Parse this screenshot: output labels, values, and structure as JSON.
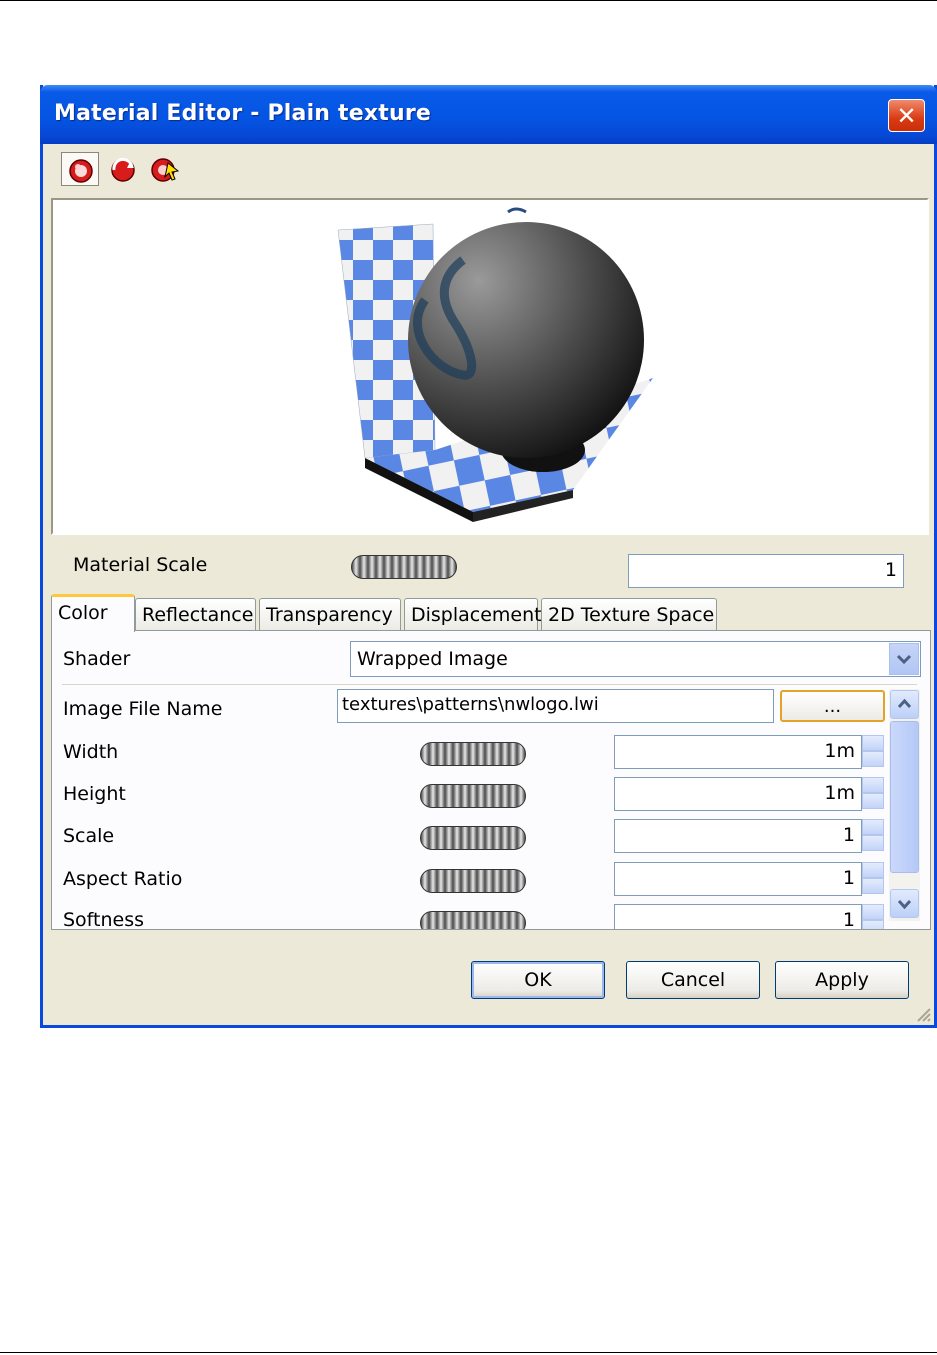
{
  "window": {
    "title": "Material Editor - Plain texture",
    "close_glyph": "✕"
  },
  "toolbar": {
    "icons": [
      "sphere-material-icon",
      "undo-material-icon",
      "pick-material-icon"
    ]
  },
  "material_scale": {
    "label": "Material Scale",
    "value": "1"
  },
  "tabs": [
    {
      "label": "Color",
      "active": true
    },
    {
      "label": "Reflectance"
    },
    {
      "label": "Transparency"
    },
    {
      "label": "Displacement"
    },
    {
      "label": "2D Texture Space"
    }
  ],
  "shader": {
    "label": "Shader",
    "value": "Wrapped Image"
  },
  "image_file": {
    "label": "Image File Name",
    "value": "textures\\patterns\\nwlogo.lwi",
    "browse_label": "..."
  },
  "properties": [
    {
      "label": "Width",
      "value": "1m"
    },
    {
      "label": "Height",
      "value": "1m"
    },
    {
      "label": "Scale",
      "value": "1"
    },
    {
      "label": "Aspect Ratio",
      "value": "1"
    },
    {
      "label": "Softness",
      "value": "1"
    }
  ],
  "buttons": {
    "ok": "OK",
    "cancel": "Cancel",
    "apply": "Apply"
  },
  "colors": {
    "title_blue": "#0555e4",
    "dialog_bg": "#ece9d8",
    "checker_blue": "#5a86e4",
    "close_red": "#d93b14"
  }
}
